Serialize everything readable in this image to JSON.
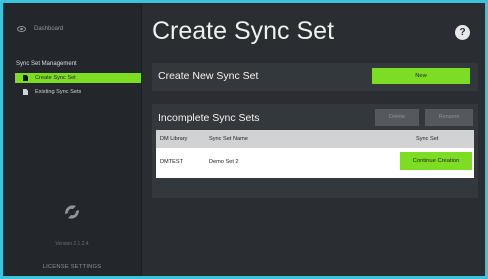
{
  "sidebar": {
    "dashboard_label": "Dashboard",
    "section_title": "Sync Set Management",
    "items": [
      {
        "label": "Create Sync Set",
        "active": true
      },
      {
        "label": "Existing Sync Sets",
        "active": false
      }
    ],
    "version": "Version 2.1.2.4",
    "license_label": "LICENSE SETTINGS"
  },
  "main": {
    "title": "Create Sync Set",
    "help_label": "?",
    "create_panel": {
      "title": "Create New Sync Set",
      "new_label": "New"
    },
    "incomplete_panel": {
      "title": "Incomplete Sync Sets",
      "delete_label": "Delete",
      "rename_label": "Rename",
      "columns": [
        "DM Library",
        "Sync Set Name",
        "Sync Set"
      ],
      "rows": [
        {
          "library": "DMTEST",
          "name": "Demo Set 2",
          "action": "Continue Creation"
        }
      ]
    }
  },
  "colors": {
    "accent": "#7ddd22",
    "background": "#2a2d31",
    "sidebar": "#23272b",
    "frame": "#3cc4dc"
  },
  "icons": {
    "dashboard": "eye-icon",
    "doc": "document-icon",
    "logo": "sync-logo-icon",
    "help": "help-icon"
  }
}
